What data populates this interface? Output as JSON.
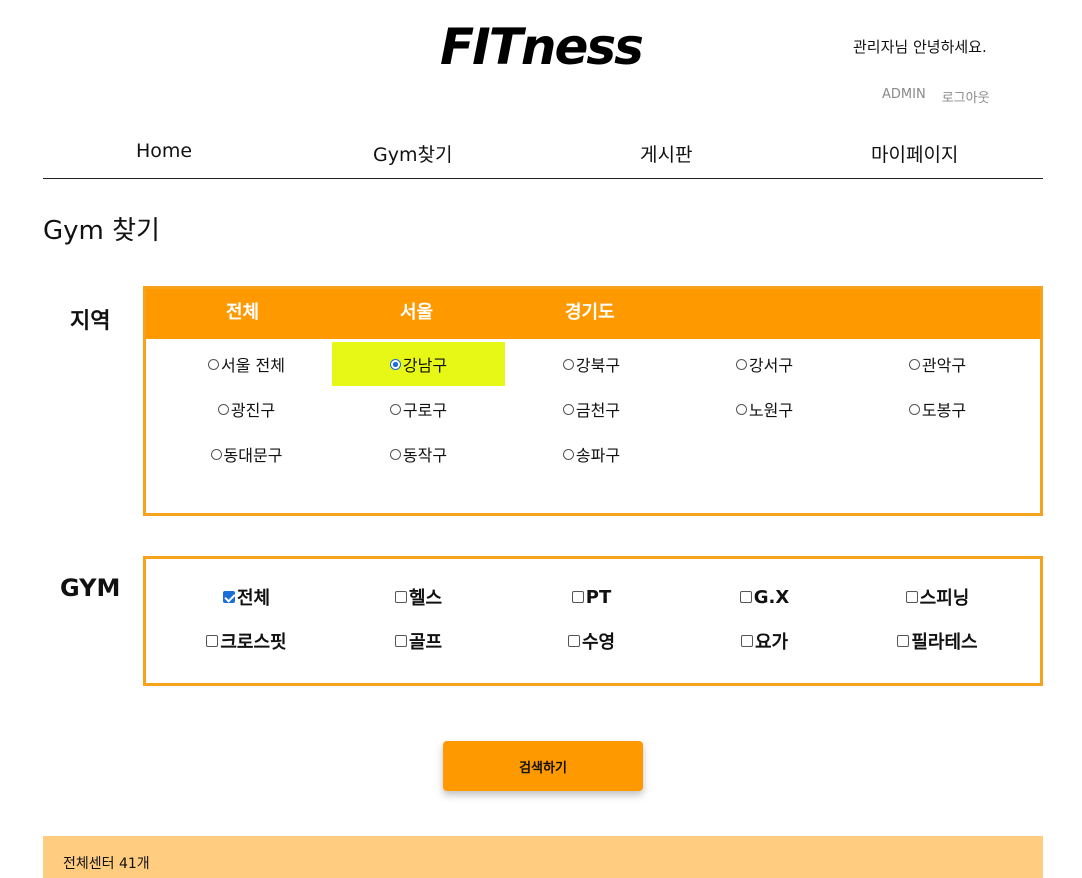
{
  "header": {
    "logo": "FITness",
    "greeting": "관리자님 안녕하세요.",
    "admin_link": "ADMIN",
    "logout_link": "로그아웃"
  },
  "nav": {
    "home": "Home",
    "gym_search": "Gym찾기",
    "board": "게시판",
    "mypage": "마이페이지"
  },
  "page_title": "Gym 찾기",
  "region": {
    "label": "지역",
    "tabs": [
      "전체",
      "서울",
      "경기도"
    ],
    "selected": "강남구",
    "options": [
      "서울 전체",
      "강남구",
      "강북구",
      "강서구",
      "관악구",
      "광진구",
      "구로구",
      "금천구",
      "노원구",
      "도봉구",
      "동대문구",
      "동작구",
      "송파구"
    ]
  },
  "gym": {
    "label": "GYM",
    "checked": [
      "전체"
    ],
    "options": [
      "전체",
      "헬스",
      "PT",
      "G.X",
      "스피닝",
      "크로스핏",
      "골프",
      "수영",
      "요가",
      "필라테스"
    ]
  },
  "search_button": "검색하기",
  "result": {
    "summary": "전체센터 41개"
  },
  "colors": {
    "accent": "#ff9900",
    "border": "#f7a21b",
    "highlight": "#e8f816",
    "result_bg": "#ffcc80"
  }
}
